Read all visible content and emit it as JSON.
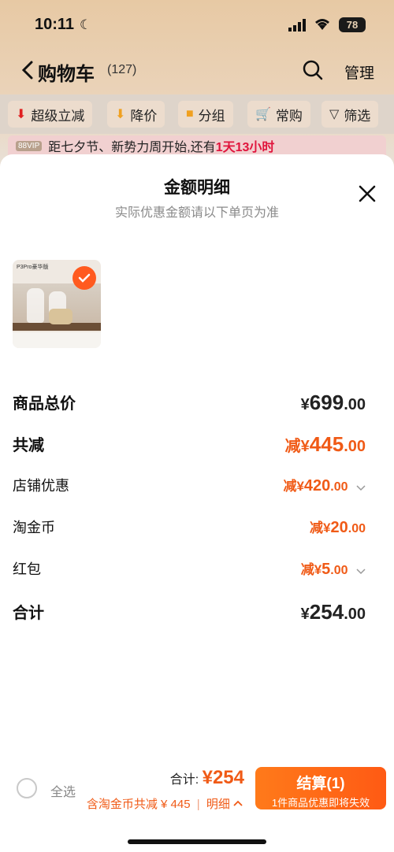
{
  "status_bar": {
    "time": "10:11",
    "battery": "78"
  },
  "nav": {
    "title": "购物车",
    "count": "(127)",
    "manage_label": "管理"
  },
  "filters": [
    {
      "label": "超级立减",
      "icon": "down-arrow-red-icon"
    },
    {
      "label": "降价",
      "icon": "down-arrow-orange-icon"
    },
    {
      "label": "分组",
      "icon": "folder-icon"
    },
    {
      "label": "常购",
      "icon": "cart-icon"
    },
    {
      "label": "筛选",
      "icon": "filter-icon"
    }
  ],
  "promo": {
    "badge": "88VIP",
    "text": "距七夕节、新势力周开始,还有",
    "highlight": "1天13小时"
  },
  "sheet": {
    "title": "金额明细",
    "subtitle": "实际优惠金额请以下单页为准",
    "product_thumb_label": "P3Pro豪华版"
  },
  "breakdown": {
    "total_price": {
      "label": "商品总价",
      "prefix": "¥",
      "integer": "699",
      "decimal": ".00"
    },
    "total_reduction": {
      "label": "共减",
      "prefix": "减¥",
      "integer": "445",
      "decimal": ".00"
    },
    "shop_discount": {
      "label": "店铺优惠",
      "prefix": "减¥",
      "integer": "420",
      "decimal": ".00"
    },
    "taojinbi": {
      "label": "淘金币",
      "prefix": "减¥",
      "integer": "20",
      "decimal": ".00"
    },
    "red_packet": {
      "label": "红包",
      "prefix": "减¥",
      "integer": "5",
      "decimal": ".00"
    },
    "grand_total": {
      "label": "合计",
      "prefix": "¥",
      "integer": "254",
      "decimal": ".00"
    }
  },
  "bottom_bar": {
    "select_all_label": "全选",
    "total_label": "合计: ",
    "total_amount": "¥254",
    "savings_text": "含淘金币共减 ¥ 445",
    "detail_link": "明细",
    "checkout_label": "结算(1)",
    "checkout_sub": "1件商品优惠即将失效"
  },
  "colors": {
    "accent": "#f05a16",
    "checkout_start": "#ff7a1a",
    "checkout_end": "#ff5a14"
  }
}
